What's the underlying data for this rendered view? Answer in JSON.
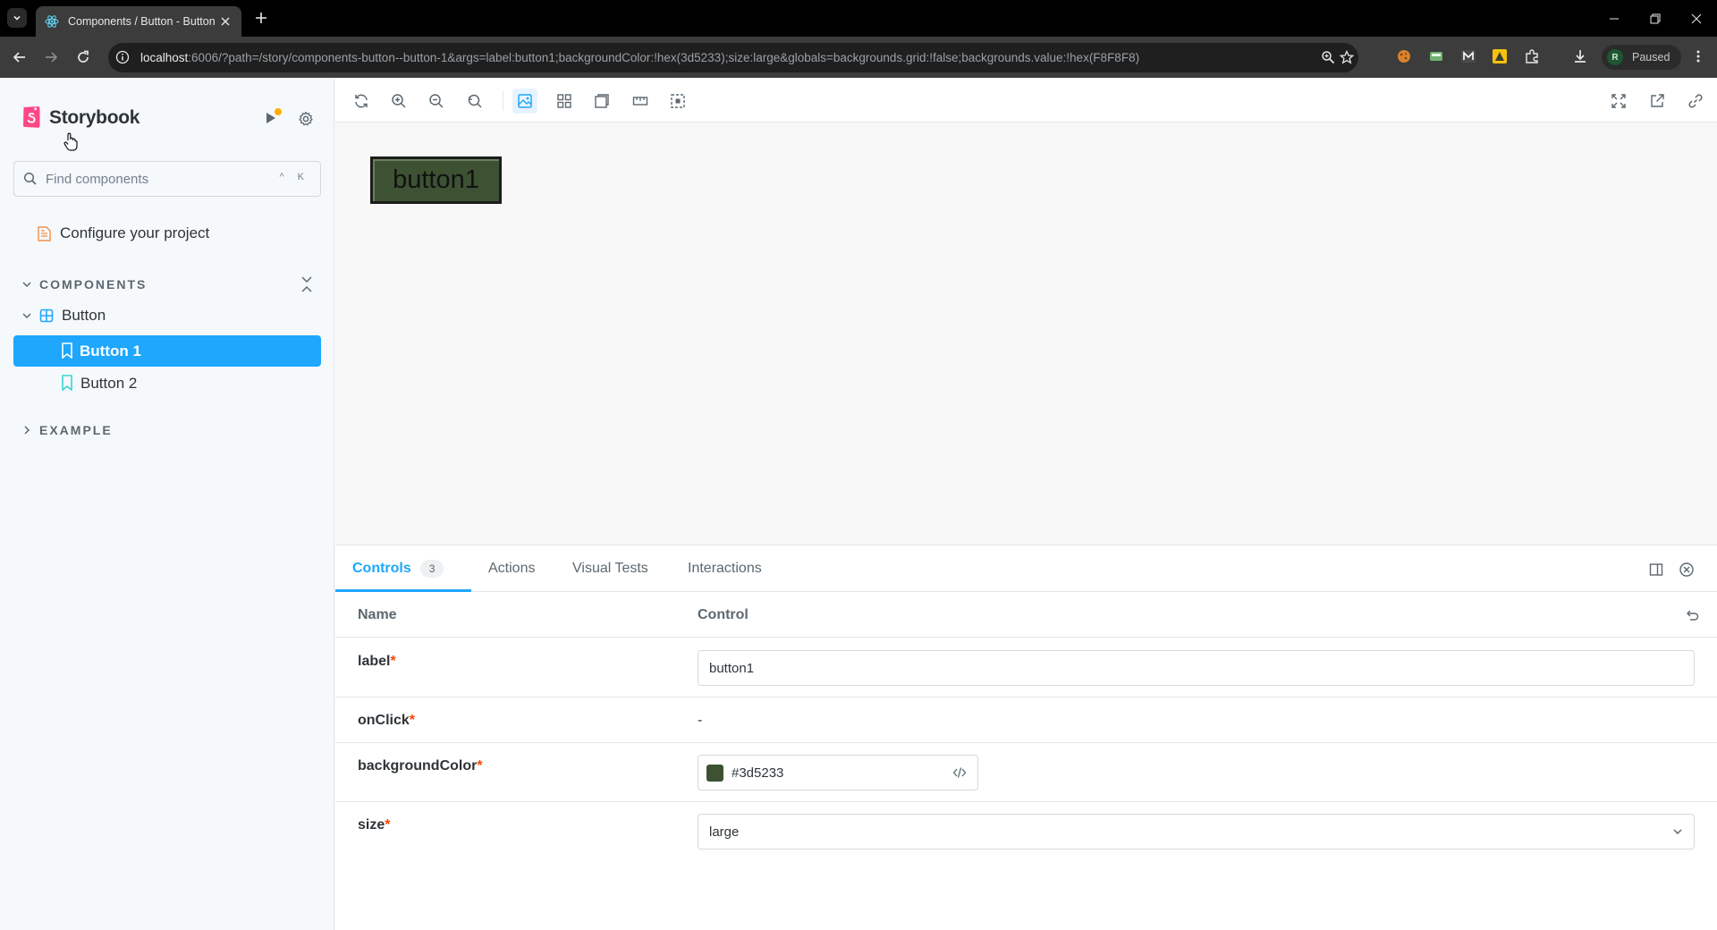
{
  "browser": {
    "tab_title": "Components / Button - Button",
    "url_host": "localhost",
    "url_rest": ":6006/?path=/story/components-button--button-1&args=label:button1;backgroundColor:!hex(3d5233);size:large&globals=backgrounds.grid:!false;backgrounds.value:!hex(F8F8F8)",
    "profile_initial": "R",
    "profile_status": "Paused"
  },
  "sidebar": {
    "brand": "Storybook",
    "search_placeholder": "Find components",
    "search_shortcut": "^ K",
    "configure_label": "Configure your project",
    "components_header": "COMPONENTS",
    "component_group": "Button",
    "stories": [
      "Button 1",
      "Button 2"
    ],
    "example_header": "EXAMPLE"
  },
  "preview": {
    "button_label": "button1",
    "button_bg": "#3d5233",
    "canvas_bg": "#F8F8F8"
  },
  "panel": {
    "tabs": [
      {
        "label": "Controls",
        "badge": "3"
      },
      {
        "label": "Actions"
      },
      {
        "label": "Visual Tests"
      },
      {
        "label": "Interactions"
      }
    ],
    "headers": {
      "name": "Name",
      "control": "Control"
    },
    "rows": {
      "label": {
        "name": "label",
        "value": "button1"
      },
      "onClick": {
        "name": "onClick",
        "value": "-"
      },
      "backgroundColor": {
        "name": "backgroundColor",
        "value": "#3d5233"
      },
      "size": {
        "name": "size",
        "value": "large"
      }
    },
    "required_marker": "*"
  },
  "colors": {
    "accent": "#1ea7fd",
    "brand_pink": "#ff4785",
    "required": "#ff4400"
  }
}
